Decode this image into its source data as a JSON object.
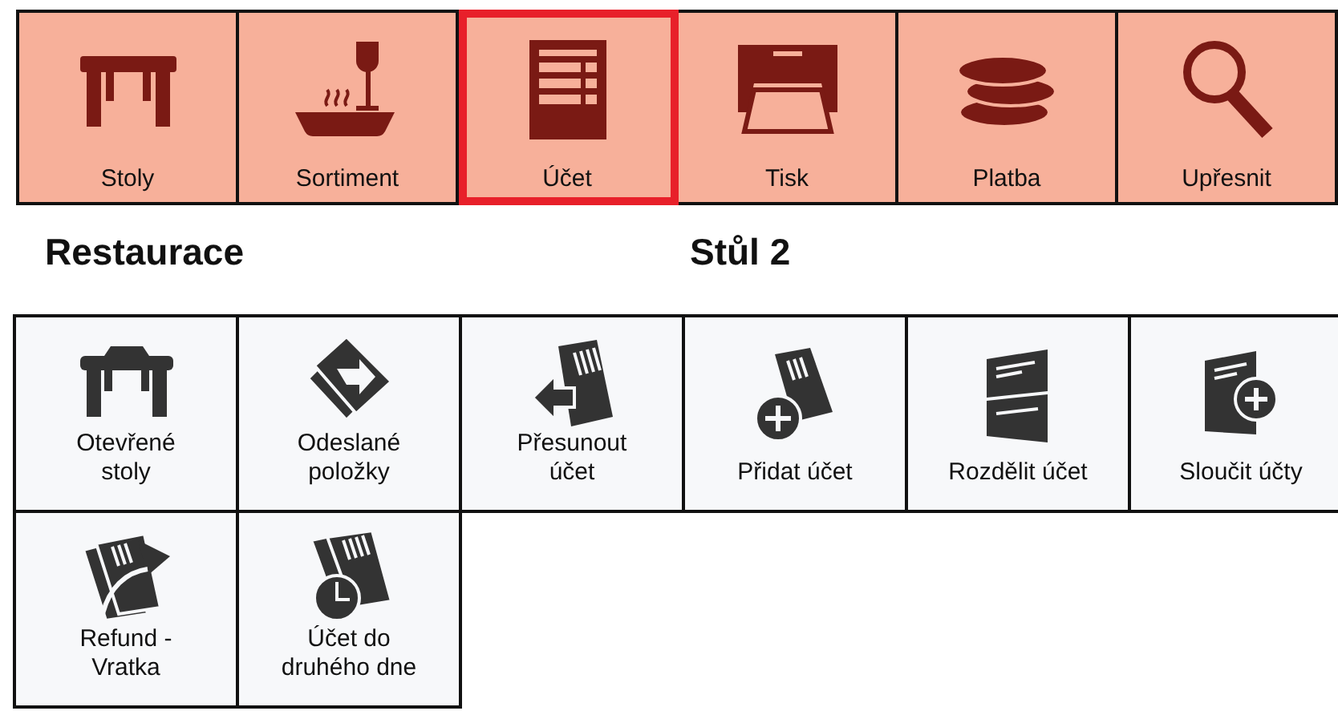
{
  "toolbar": [
    {
      "label": "Stoly",
      "selected": false
    },
    {
      "label": "Sortiment",
      "selected": false
    },
    {
      "label": "Účet",
      "selected": true
    },
    {
      "label": "Tisk",
      "selected": false
    },
    {
      "label": "Platba",
      "selected": false
    },
    {
      "label": "Upřesnit",
      "selected": false
    }
  ],
  "section_title": "Restaurace",
  "table_title": "Stůl 2",
  "actions": [
    {
      "label": "Otevřené stoly"
    },
    {
      "label": "Odeslané položky"
    },
    {
      "label": "Přesunout účet"
    },
    {
      "label": "Přidat účet"
    },
    {
      "label": "Rozdělit účet"
    },
    {
      "label": "Sloučit účty"
    },
    {
      "label": "Refund - Vratka"
    },
    {
      "label": "Účet do druhého dne"
    }
  ]
}
